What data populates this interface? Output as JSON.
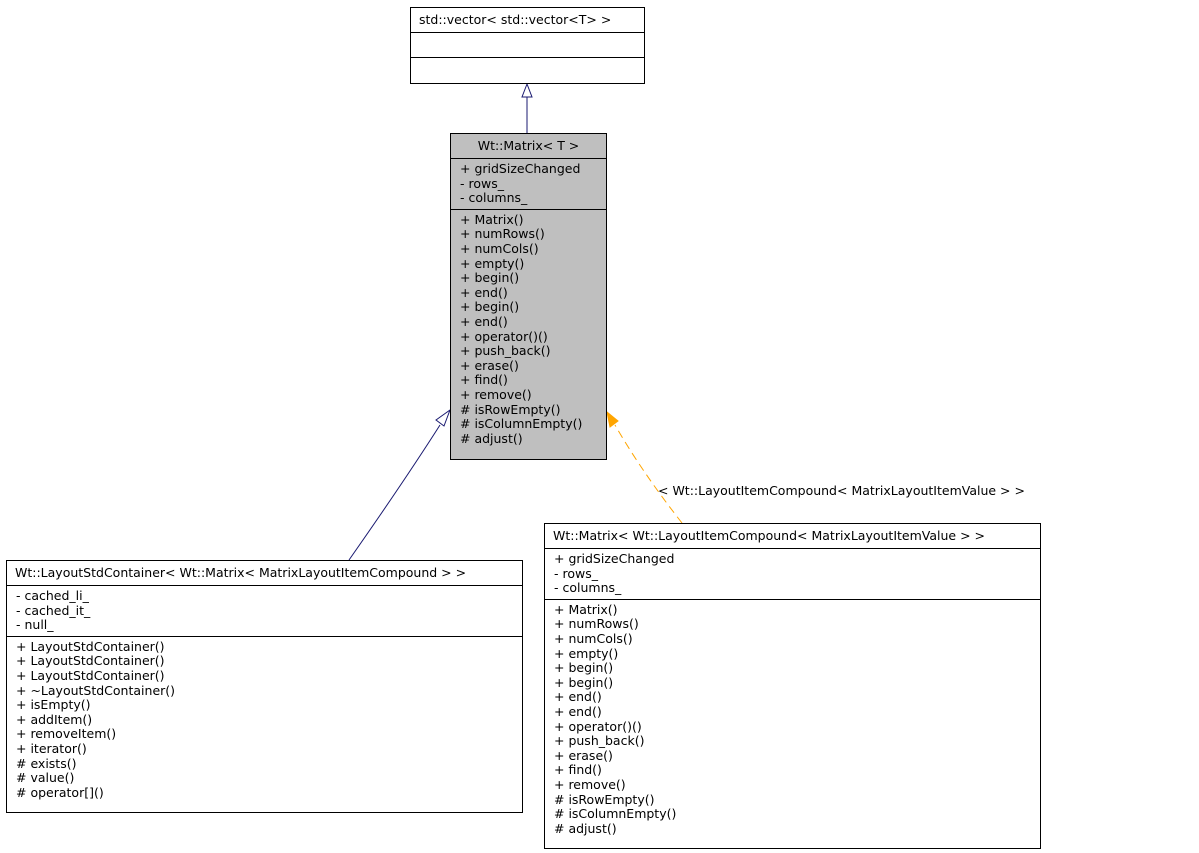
{
  "colors": {
    "focus_fill": "#bfbfbf",
    "inheritance_edge": "#191970",
    "template_edge": "#ffa500",
    "border": "#000000"
  },
  "classes": {
    "vector": {
      "title": "std::vector< std::vector<T> >",
      "attributes": [],
      "methods": []
    },
    "matrix": {
      "title": "Wt::Matrix< T >",
      "attributes": [
        "+ gridSizeChanged",
        "- rows_",
        "- columns_"
      ],
      "methods": [
        "+ Matrix()",
        "+ numRows()",
        "+ numCols()",
        "+ empty()",
        "+ begin()",
        "+ end()",
        "+ begin()",
        "+ end()",
        "+ operator()()",
        "+ push_back()",
        "+ erase()",
        "+ find()",
        "+ remove()",
        "# isRowEmpty()",
        "# isColumnEmpty()",
        "# adjust()"
      ]
    },
    "container": {
      "title": "Wt::LayoutStdContainer< Wt::Matrix< MatrixLayoutItemCompound > >",
      "attributes": [
        "- cached_li_",
        "- cached_it_",
        "- null_"
      ],
      "methods": [
        "+ LayoutStdContainer()",
        "+ LayoutStdContainer()",
        "+ LayoutStdContainer()",
        "+ ~LayoutStdContainer()",
        "+ isEmpty()",
        "+ addItem()",
        "+ removeItem()",
        "+ iterator()",
        "# exists()",
        "# value()",
        "# operator[]()"
      ]
    },
    "matrix_inst": {
      "title": "Wt::Matrix< Wt::LayoutItemCompound< MatrixLayoutItemValue > >",
      "attributes": [
        "+ gridSizeChanged",
        "- rows_",
        "- columns_"
      ],
      "methods": [
        "+ Matrix()",
        "+ numRows()",
        "+ numCols()",
        "+ empty()",
        "+ begin()",
        "+ begin()",
        "+ end()",
        "+ end()",
        "+ operator()()",
        "+ push_back()",
        "+ erase()",
        "+ find()",
        "+ remove()",
        "# isRowEmpty()",
        "# isColumnEmpty()",
        "# adjust()"
      ]
    }
  },
  "edges": {
    "template_binding_label": "< Wt::LayoutItemCompound< MatrixLayoutItemValue > >"
  }
}
